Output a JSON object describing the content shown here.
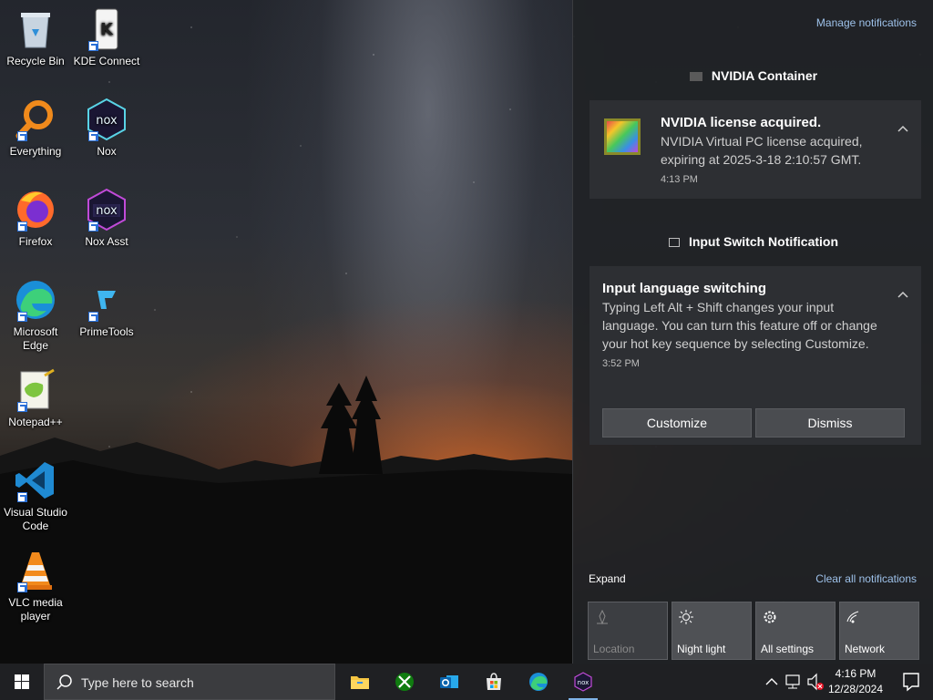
{
  "desktop": {
    "icons": [
      {
        "label": "Recycle Bin",
        "icon": "recycle-bin-icon"
      },
      {
        "label": "KDE Connect",
        "icon": "kde-connect-icon"
      },
      {
        "label": "Everything",
        "icon": "everything-icon"
      },
      {
        "label": "Nox",
        "icon": "nox-icon"
      },
      {
        "label": "Firefox",
        "icon": "firefox-icon"
      },
      {
        "label": "Nox Asst",
        "icon": "nox-asst-icon"
      },
      {
        "label": "Microsoft Edge",
        "icon": "edge-icon"
      },
      {
        "label": "PrimeTools",
        "icon": "primetools-icon"
      },
      {
        "label": "Notepad++",
        "icon": "notepadpp-icon"
      },
      {
        "label": "Visual Studio Code",
        "icon": "vscode-icon"
      },
      {
        "label": "VLC media player",
        "icon": "vlc-icon"
      }
    ]
  },
  "action_center": {
    "manage_link": "Manage notifications",
    "groups": [
      {
        "app": "NVIDIA Container",
        "notification": {
          "title": "NVIDIA license acquired.",
          "body": "NVIDIA Virtual PC license acquired, expiring at 2025-3-18 2:10:57 GMT.",
          "time": "4:13 PM"
        }
      },
      {
        "app": "Input Switch Notification",
        "notification": {
          "title": "Input language switching",
          "body": "Typing Left Alt + Shift changes your input language. You can turn this feature off or change your hot key sequence by selecting Customize.",
          "time": "3:52 PM",
          "buttons": [
            "Customize",
            "Dismiss"
          ]
        }
      }
    ],
    "expand_label": "Expand",
    "clear_all_label": "Clear all notifications",
    "quick_actions": [
      {
        "label": "Location",
        "state": "off",
        "icon": "location-icon"
      },
      {
        "label": "Night light",
        "state": "on",
        "icon": "night-light-icon"
      },
      {
        "label": "All settings",
        "state": "on",
        "icon": "settings-icon"
      },
      {
        "label": "Network",
        "state": "on",
        "icon": "network-icon"
      }
    ]
  },
  "taskbar": {
    "search_placeholder": "Type here to search",
    "pinned_apps": [
      "file-explorer-icon",
      "xbox-icon",
      "outlook-icon",
      "microsoft-store-icon",
      "edge-icon",
      "nox-icon"
    ],
    "clock": {
      "time": "4:16 PM",
      "date": "12/28/2024"
    }
  },
  "colors": {
    "accent": "#7fb3e8",
    "link": "#9ec2ea",
    "taskbar_bg": "#1f2023",
    "action_center_bg": "#202226"
  }
}
